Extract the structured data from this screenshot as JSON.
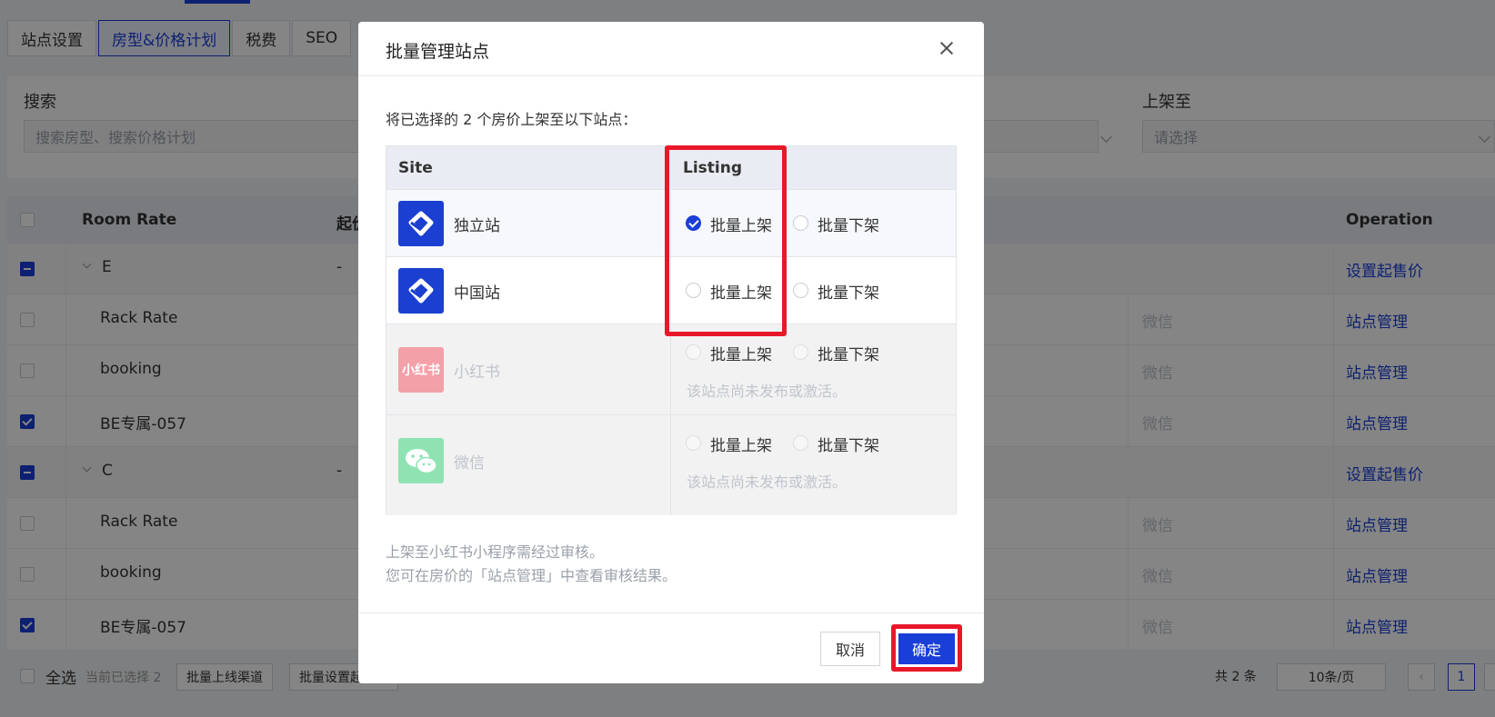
{
  "page_tabs": [
    "站点设置",
    "房型&价格计划",
    "税费",
    "SEO"
  ],
  "filter": {
    "search_label": "搜索",
    "search_placeholder": "搜索房型、搜索价格计划",
    "listing_label": "上架至",
    "listing_placeholder": "请选择"
  },
  "table": {
    "col_room_rate": "Room Rate",
    "col_start_price": "起价",
    "col_operation": "Operation",
    "rows": [
      {
        "kind": "group",
        "name": "E",
        "price": "-",
        "channel": "",
        "op": "设置起售价",
        "check": "partial"
      },
      {
        "kind": "item",
        "name": "Rack Rate",
        "price": "",
        "channel": "微信",
        "op": "站点管理",
        "check": "none"
      },
      {
        "kind": "item",
        "name": "booking",
        "price": "",
        "channel": "微信",
        "op": "站点管理",
        "check": "none"
      },
      {
        "kind": "item",
        "name": "BE专属-057",
        "price": "",
        "channel": "微信",
        "op": "站点管理",
        "check": "checked"
      },
      {
        "kind": "group",
        "name": "C",
        "price": "-",
        "channel": "",
        "op": "设置起售价",
        "check": "partial"
      },
      {
        "kind": "item",
        "name": "Rack Rate",
        "price": "",
        "channel": "微信",
        "op": "站点管理",
        "check": "none"
      },
      {
        "kind": "item",
        "name": "booking",
        "price": "",
        "channel": "微信",
        "op": "站点管理",
        "check": "none"
      },
      {
        "kind": "item",
        "name": "BE专属-057",
        "price": "",
        "channel": "微信",
        "op": "站点管理",
        "check": "checked"
      }
    ]
  },
  "footer": {
    "select_all": "全选",
    "selected_text": "当前已选择 2",
    "batch_online": "批量上线渠道",
    "batch_set": "批量设置起",
    "total": "共 2 条",
    "page_size": "10条/页",
    "current_page": "1"
  },
  "modal": {
    "title": "批量管理站点",
    "description": "将已选择的 2 个房价上架至以下站点：",
    "col_site": "Site",
    "col_listing": "Listing",
    "sites": [
      {
        "name": "独立站",
        "on_label": "批量上架",
        "off_label": "批量下架",
        "selected": "on",
        "disabled": false,
        "note": ""
      },
      {
        "name": "中国站",
        "on_label": "批量上架",
        "off_label": "批量下架",
        "selected": "none",
        "disabled": false,
        "note": ""
      },
      {
        "name": "小红书",
        "logo_text": "小红书",
        "on_label": "批量上架",
        "off_label": "批量下架",
        "selected": "none",
        "disabled": true,
        "note": "该站点尚未发布或激活。"
      },
      {
        "name": "微信",
        "on_label": "批量上架",
        "off_label": "批量下架",
        "selected": "none",
        "disabled": true,
        "note": "该站点尚未发布或激活。"
      }
    ],
    "hint_line1": "上架至小红书小程序需经过审核。",
    "hint_line2": "您可在房价的「站点管理」中查看审核结果。",
    "cancel_label": "取消",
    "ok_label": "确定"
  },
  "colors": {
    "brand": "#1a3ed8",
    "highlight": "#e8182a"
  }
}
